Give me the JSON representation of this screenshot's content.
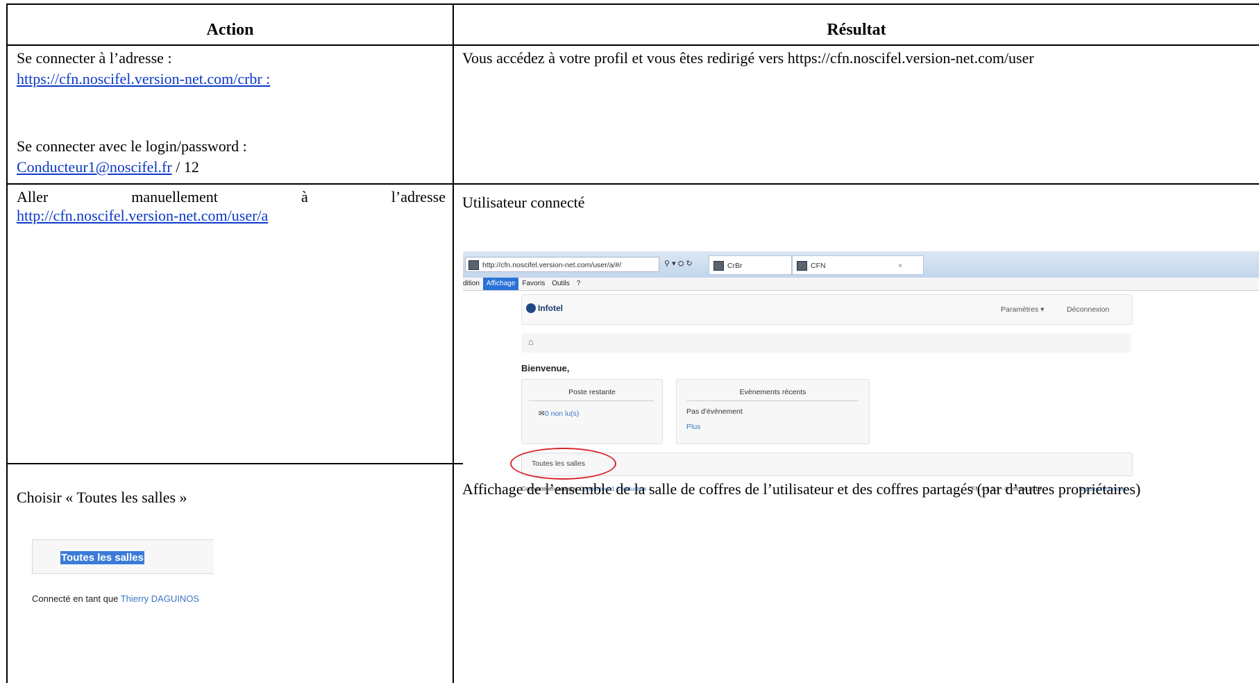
{
  "table": {
    "headers": {
      "action": "Action",
      "result": "Résultat"
    },
    "rows": [
      {
        "action_line1": "Se connecter à l’adresse :",
        "action_link1": "https://cfn.noscifel.version-net.com/crbr :",
        "action_line2": "Se connecter avec le login/password :",
        "action_link2": "Conducteur1@noscifel.fr",
        "action_suffix2": " / 12",
        "result": "Vous accédez à votre profil et vous êtes redirigé vers https://cfn.noscifel.version-net.com/user"
      },
      {
        "action_words": [
          "Aller",
          "manuellement",
          "à",
          "l’adresse"
        ],
        "action_link": "http://cfn.noscifel.version-net.com/user/a",
        "result": "Utilisateur connecté"
      },
      {
        "action": "Choisir « Toutes les salles »",
        "result": "Affichage de l’ensemble de la salle de coffres de l’utilisateur et des coffres partagés (par d’autres propriétaires)"
      }
    ]
  },
  "screenshot": {
    "address": "http://cfn.noscifel.version-net.com/user/a/#/",
    "addr_controls": "⚲ ▾ ⛭ ↻",
    "tab1": "CrBr",
    "tab2": "CFN",
    "tab_close": "×",
    "menu": [
      "dition",
      "Affichage",
      "Favoris",
      "Outils",
      "?"
    ],
    "logo": "Infotel",
    "nav_right": [
      "Paramètres ▾",
      "Déconnexion"
    ],
    "home_icon": "⌂",
    "welcome": "Bienvenue,",
    "panel1_title": "Poste restante",
    "panel1_item": "0 non lu(s)",
    "panel2_title": "Evènements récents",
    "panel2_item": "Pas d'évènement",
    "panel2_link": "Plus",
    "salles": "Toutes les salles",
    "footer_prefix": "Connecté en tant que ",
    "footer_user": "Conducteur 1 Conducteur 1",
    "footer_version": "CFN 4.2.2.3 - © Infotel 2013",
    "footer_support": "Support technique"
  },
  "crop": {
    "salles": "Toutes les salles",
    "footer_prefix": "Connecté en tant que ",
    "footer_user": "Thierry DAGUINOS"
  }
}
